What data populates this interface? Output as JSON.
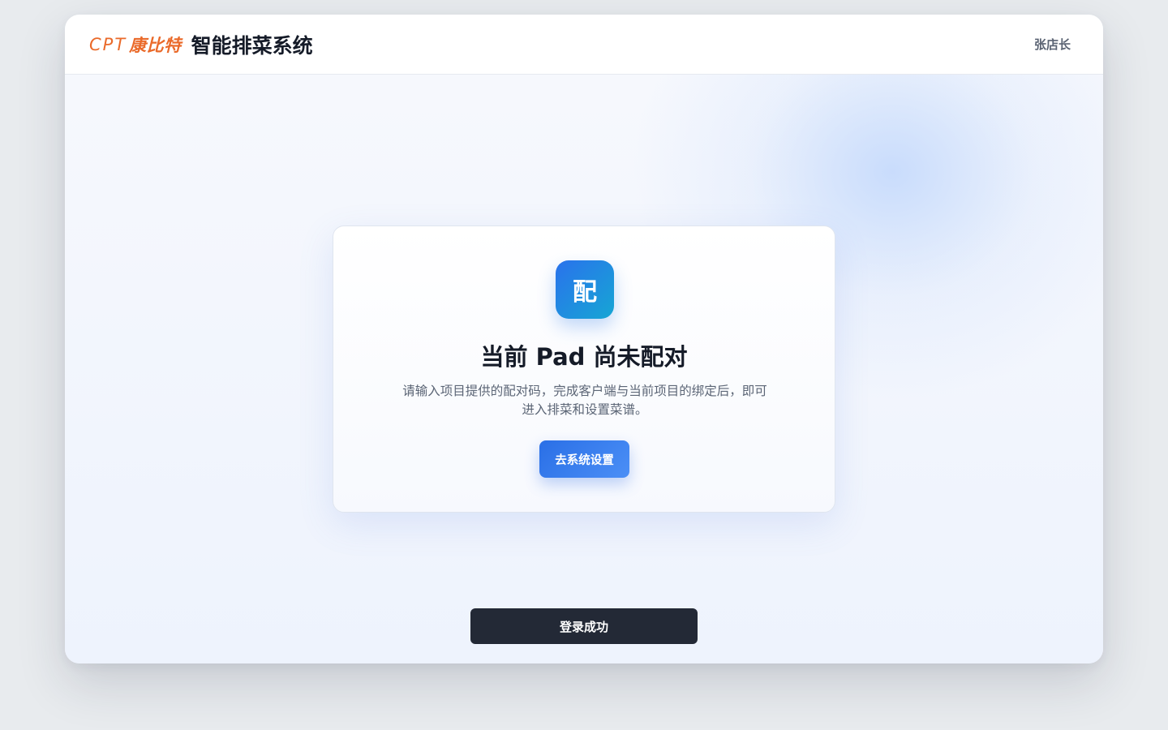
{
  "header": {
    "brand_latin": "CPT",
    "brand_cn": "康比特",
    "app_title": "智能排菜系统",
    "user_name": "张店长"
  },
  "pairing_card": {
    "badge_char": "配",
    "title": "当前 Pad 尚未配对",
    "description": "请输入项目提供的配对码，完成客户端与当前项目的绑定后，即可进入排菜和设置菜谱。",
    "button_label": "去系统设置"
  },
  "toast": {
    "message": "登录成功"
  },
  "colors": {
    "brand_orange": "#ea6a2a",
    "primary_blue": "#2a6fe6",
    "toast_bg": "#232936"
  }
}
